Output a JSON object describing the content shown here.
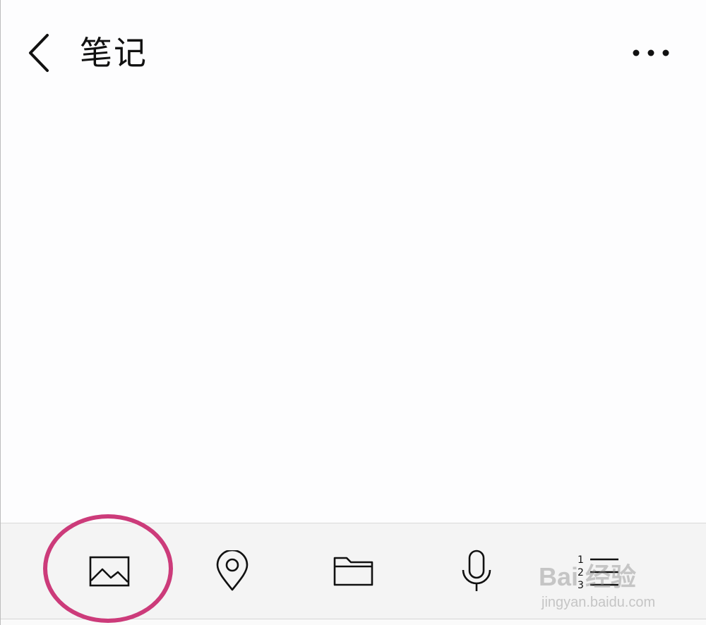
{
  "header": {
    "title": "笔记",
    "back_icon": "chevron-left-icon",
    "more_icon": "more-horizontal-icon"
  },
  "toolbar": {
    "items": [
      {
        "name": "insert-image",
        "icon": "image-icon"
      },
      {
        "name": "insert-location",
        "icon": "location-pin-icon"
      },
      {
        "name": "insert-file",
        "icon": "folder-icon"
      },
      {
        "name": "record-audio",
        "icon": "microphone-icon"
      },
      {
        "name": "numbered-list",
        "icon": "numbered-list-icon"
      }
    ]
  },
  "annotation": {
    "highlight_color": "#cc3b7a",
    "highlighted_item": "insert-image"
  },
  "watermark": {
    "brand": "Bai 经验",
    "url": "jingyan.baidu.com"
  }
}
